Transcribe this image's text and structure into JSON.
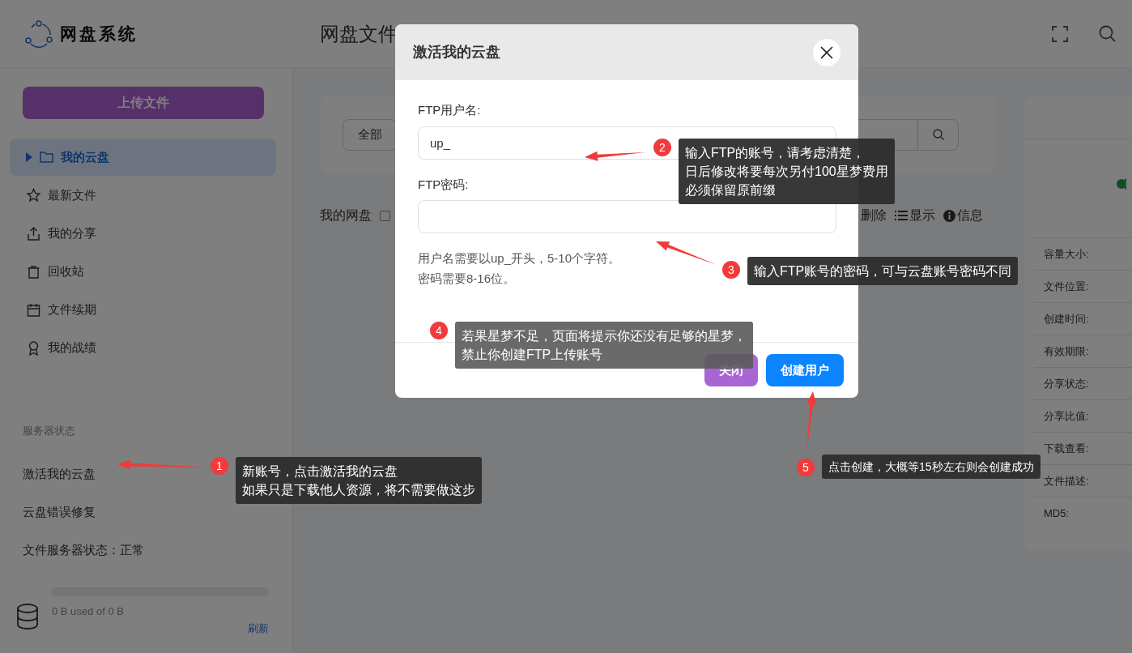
{
  "header": {
    "logo_text": "网盘系统",
    "title": "网盘文件"
  },
  "sidebar": {
    "upload_button": "上传文件",
    "nav": [
      {
        "label": "我的云盘",
        "selected": true
      },
      {
        "label": "最新文件",
        "selected": false
      },
      {
        "label": "我的分享",
        "selected": false
      },
      {
        "label": "回收站",
        "selected": false
      },
      {
        "label": "文件续期",
        "selected": false
      },
      {
        "label": "我的战绩",
        "selected": false
      }
    ],
    "section_title": "服务器状态",
    "links": [
      "激活我的云盘",
      "云盘错误修复",
      "文件服务器状态：正常"
    ],
    "storage": {
      "level": 0,
      "text": "0 B used of 0 B",
      "refresh": "刷新"
    }
  },
  "search_panel": {
    "filter": "全部"
  },
  "toolbar": {
    "title": "我的网盘",
    "checked": false,
    "actions": [
      "删除",
      "显示",
      "信息"
    ]
  },
  "details": {
    "labels": [
      "容量大小:",
      "文件位置:",
      "创建时间:",
      "有效期限:",
      "分享状态:",
      "分享比值:",
      "下载查看:",
      "文件描述:",
      "MD5:"
    ]
  },
  "modal": {
    "title": "激活我的云盘",
    "fields": [
      {
        "label": "FTP用户名:",
        "value": "up_"
      },
      {
        "label": "FTP密码:"
      }
    ],
    "hints": [
      "用户名需要以up_开头，5-10个字符。",
      "密码需要8-16位。"
    ],
    "buttons": [
      {
        "label": "关闭",
        "kind": "secondary"
      },
      {
        "label": "创建用户",
        "kind": "primary"
      }
    ]
  },
  "callouts": [
    {
      "number": "1",
      "lines": [
        "新账号，点击激活我的云盘",
        "如果只是下载他人资源，将不需要做这步"
      ]
    },
    {
      "number": "2",
      "lines": [
        "输入FTP的账号，请考虑清楚，",
        "日后修改将要每次另付100星梦费用",
        "必须保留原前缀"
      ]
    },
    {
      "number": "3",
      "lines": [
        "输入FTP账号的密码，可与云盘账号密码不同"
      ]
    },
    {
      "number": "4",
      "lines": [
        "若果星梦不足，页面将提示你还没有足够的星梦，",
        "禁止你创建FTP上传账号"
      ]
    },
    {
      "number": "5",
      "lines": [
        "点击创建，大概等15秒左右则会创建成功"
      ]
    }
  ]
}
